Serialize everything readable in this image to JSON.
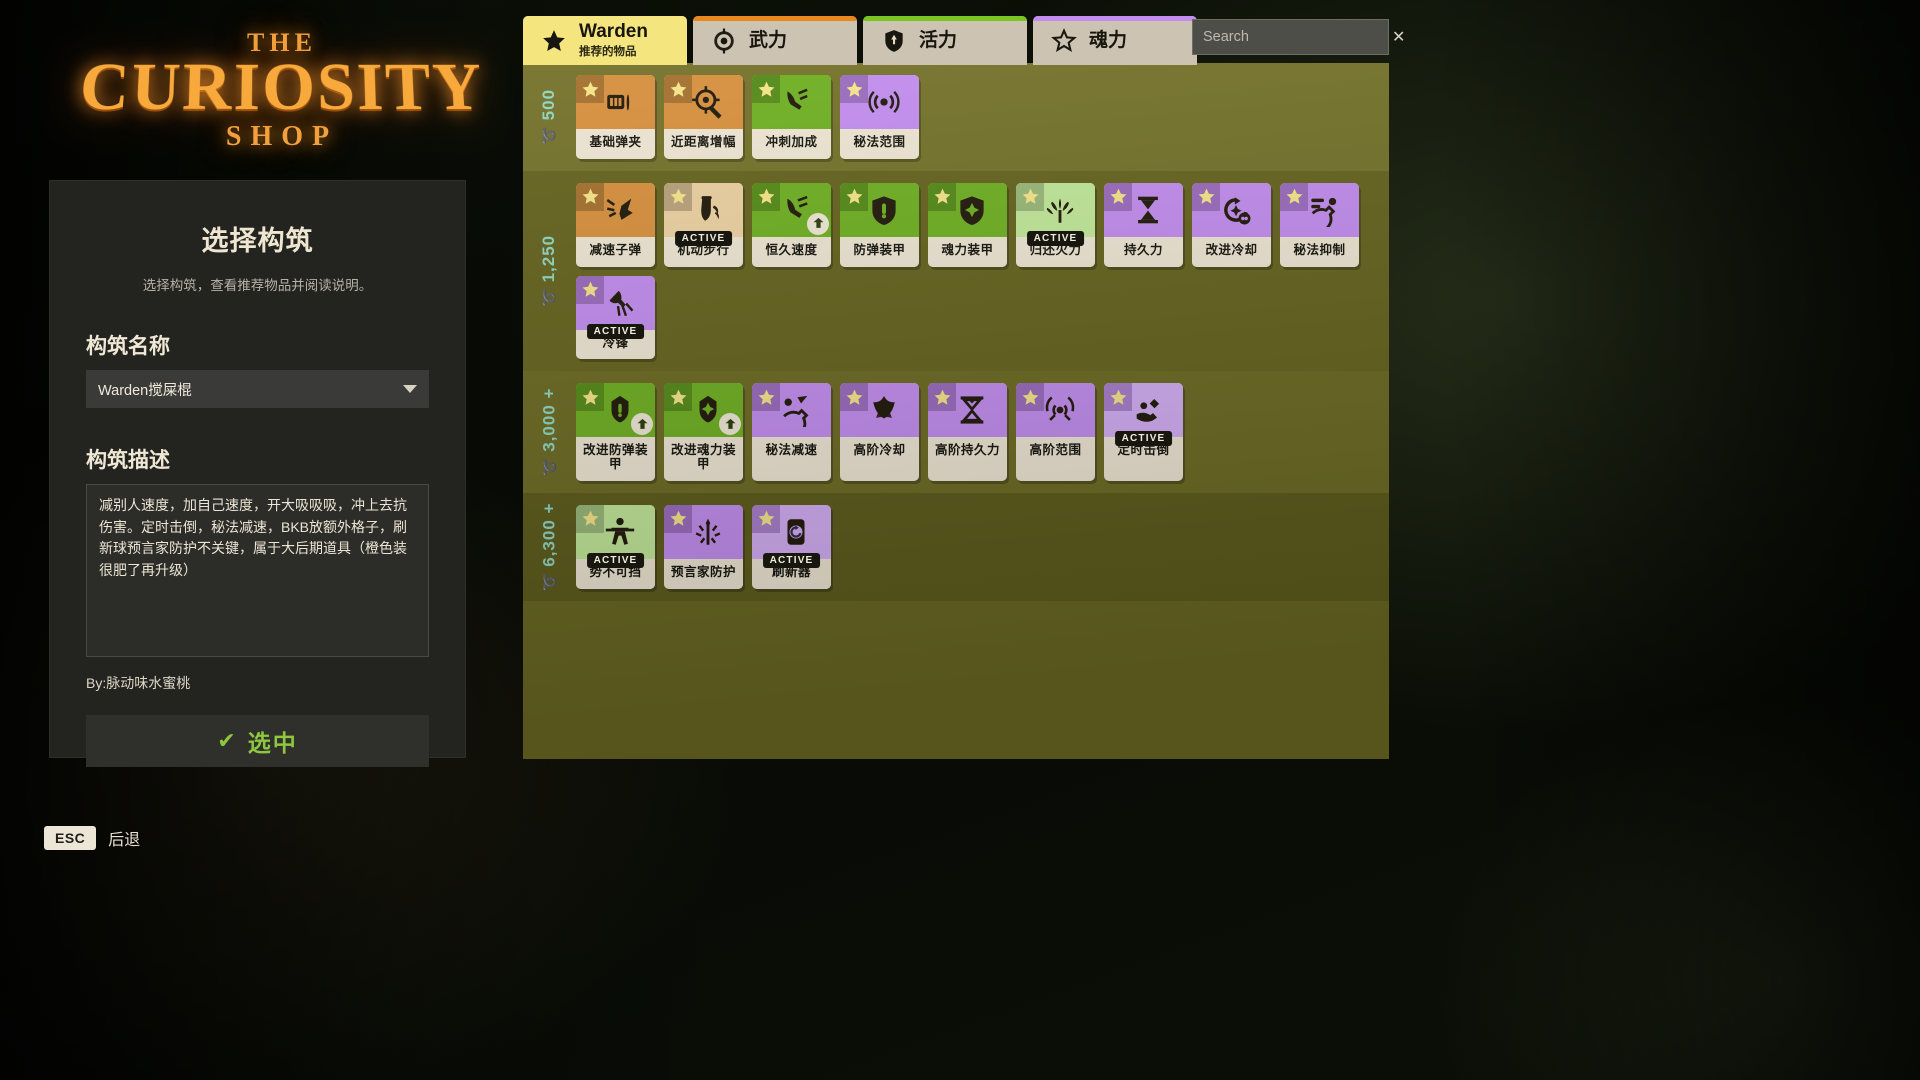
{
  "logo": {
    "line1": "THE",
    "line2": "CURIOSITY",
    "line3": "SHOP"
  },
  "panel": {
    "title": "选择构筑",
    "subtitle": "选择构筑，查看推荐物品并阅读说明。",
    "name_label": "构筑名称",
    "name_value": "Warden搅屎棍",
    "desc_label": "构筑描述",
    "desc_value": "减别人速度，加自己速度，开大吸吸吸，冲上去抗伤害。定时击倒，秘法减速，BKB放额外格子，刷新球预言家防护不关键，属于大后期道具（橙色装很肥了再升级）",
    "byline": "By:脉动味水蜜桃",
    "select_button": "选中",
    "check_glyph": "✔"
  },
  "footer": {
    "esc_key": "ESC",
    "esc_label": "后退"
  },
  "search": {
    "placeholder": "Search",
    "value": "",
    "clear_glyph": "✕"
  },
  "tabs": [
    {
      "label": "Warden",
      "sublabel": "推荐的物品",
      "icon": "star-icon",
      "active": true,
      "accent": "#f5e57e"
    },
    {
      "label": "武力",
      "sublabel": "",
      "icon": "weapon-target-icon",
      "active": false,
      "accent": "#e8881d"
    },
    {
      "label": "活力",
      "sublabel": "",
      "icon": "vitality-shield-icon",
      "active": false,
      "accent": "#79c623"
    },
    {
      "label": "魂力",
      "sublabel": "",
      "icon": "spirit-star-icon",
      "active": false,
      "accent": "#c38ef0"
    }
  ],
  "tiers": [
    {
      "price": "500",
      "items": [
        {
          "name": "基础弹夹",
          "color": "c-orange",
          "icon": "ammo-clip-icon",
          "active": false,
          "corner": ""
        },
        {
          "name": "近距离增幅",
          "color": "c-orange",
          "icon": "scope-target-icon",
          "active": false,
          "corner": ""
        },
        {
          "name": "冲刺加成",
          "color": "c-green",
          "icon": "sprint-boot-icon",
          "active": false,
          "corner": ""
        },
        {
          "name": "秘法范围",
          "color": "c-purple",
          "icon": "arcane-range-icon",
          "active": false,
          "corner": ""
        }
      ]
    },
    {
      "price": "1,250",
      "items": [
        {
          "name": "减速子弹",
          "color": "c-orange",
          "icon": "slow-bullet-icon",
          "active": false,
          "corner": ""
        },
        {
          "name": "机动步行",
          "color": "c-tan",
          "icon": "mobility-boot-icon",
          "active": true,
          "corner": ""
        },
        {
          "name": "恒久速度",
          "color": "c-green",
          "icon": "enduring-speed-icon",
          "active": false,
          "corner": "upgrade-icon"
        },
        {
          "name": "防弹装甲",
          "color": "c-green",
          "icon": "bullet-armor-icon",
          "active": false,
          "corner": ""
        },
        {
          "name": "魂力装甲",
          "color": "c-green",
          "icon": "spirit-armor-icon",
          "active": false,
          "corner": ""
        },
        {
          "name": "归还火力",
          "color": "c-ltgreen",
          "icon": "return-fire-icon",
          "active": true,
          "corner": ""
        },
        {
          "name": "持久力",
          "color": "c-purple",
          "icon": "hourglass-icon",
          "active": false,
          "corner": ""
        },
        {
          "name": "改进冷却",
          "color": "c-purple",
          "icon": "cooldown-icon",
          "active": false,
          "corner": ""
        },
        {
          "name": "秘法抑制",
          "color": "c-purple",
          "icon": "arcane-surge-icon",
          "active": false,
          "corner": ""
        },
        {
          "name": "冷锋",
          "color": "c-purple",
          "icon": "cold-front-icon",
          "active": true,
          "corner": ""
        }
      ]
    },
    {
      "price": "3,000 +",
      "items": [
        {
          "name": "改进防弹装甲",
          "color": "c-green",
          "icon": "improved-bullet-armor-icon",
          "active": false,
          "corner": "upgrade-icon"
        },
        {
          "name": "改进魂力装甲",
          "color": "c-green",
          "icon": "improved-spirit-armor-icon",
          "active": false,
          "corner": "upgrade-icon"
        },
        {
          "name": "秘法减速",
          "color": "c-purple",
          "icon": "arcane-slow-icon",
          "active": false,
          "corner": ""
        },
        {
          "name": "高阶冷却",
          "color": "c-purple",
          "icon": "superior-cooldown-icon",
          "active": false,
          "corner": ""
        },
        {
          "name": "高阶持久力",
          "color": "c-purple",
          "icon": "superior-duration-icon",
          "active": false,
          "corner": ""
        },
        {
          "name": "高阶范围",
          "color": "c-purple",
          "icon": "superior-range-icon",
          "active": false,
          "corner": ""
        },
        {
          "name": "定时击倒",
          "color": "c-ltpurple",
          "icon": "knockdown-icon",
          "active": true,
          "corner": ""
        }
      ]
    },
    {
      "price": "6,300 +",
      "items": [
        {
          "name": "势不可挡",
          "color": "c-ltgreen",
          "icon": "unstoppable-icon",
          "active": true,
          "corner": ""
        },
        {
          "name": "预言家防护",
          "color": "c-purple",
          "icon": "diviners-kevlar-icon",
          "active": false,
          "corner": ""
        },
        {
          "name": "刷新器",
          "color": "c-ltpurple",
          "icon": "refresher-icon",
          "active": true,
          "corner": ""
        }
      ]
    }
  ]
}
